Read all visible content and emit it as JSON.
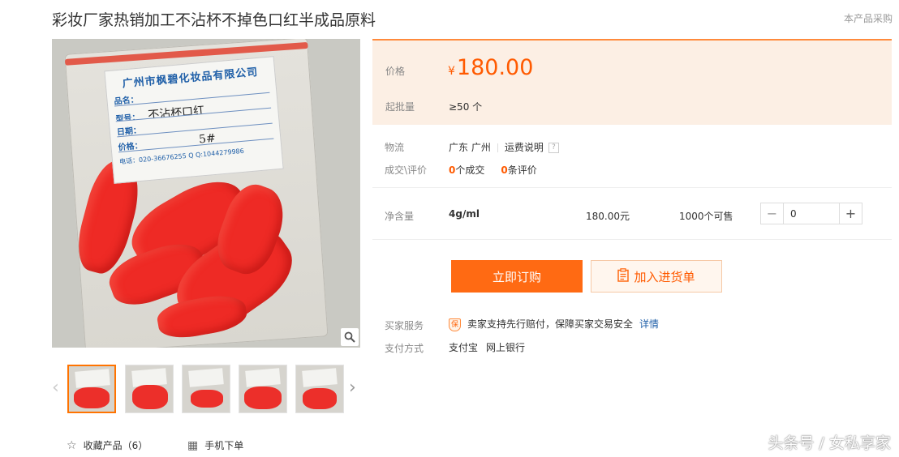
{
  "product": {
    "title": "彩妆厂家热销加工不沾杯不掉色口红半成品原料",
    "purchase_link": "本产品采购"
  },
  "image_label": {
    "company": "广州市枫碧化妆品有限公司",
    "name_label": "品名：",
    "model_label": "型号：",
    "model_value": "不沾杯口红",
    "date_label": "日期：",
    "price_label": "价格：",
    "price_value": "5#",
    "contact": "电话：020-36676255   Q Q:1044279986"
  },
  "price_section": {
    "price_label": "价格",
    "currency": "¥",
    "price": "180.00",
    "moq_label": "起批量",
    "moq_value": "≥50 个"
  },
  "logistics": {
    "label": "物流",
    "location": "广东 广州",
    "shipping_link": "运费说明",
    "help_icon": "?"
  },
  "deals": {
    "label": "成交\\评价",
    "orders_count": "0",
    "orders_text": "个成交",
    "reviews_count": "0",
    "reviews_text": "条评价"
  },
  "sku": {
    "label": "净含量",
    "spec": "4g/ml",
    "price": "180.00元",
    "stock": "1000个可售",
    "quantity": "0",
    "minus": "−",
    "plus": "+"
  },
  "actions": {
    "buy_now": "立即订购",
    "add_to_list": "加入进货单"
  },
  "services": {
    "label": "买家服务",
    "badge": "保",
    "text": "卖家支持先行赔付，保障买家交易安全",
    "link": "详情"
  },
  "payment": {
    "label": "支付方式",
    "methods": [
      "支付宝",
      "网上银行"
    ]
  },
  "footer": {
    "favorite": "收藏产品（6）",
    "mobile_order": "手机下单"
  },
  "watermark": "头条号 / 女私享家",
  "colors": {
    "accent": "#ff5a00",
    "buy_button": "#ff6a13",
    "price_bg": "#fcefe4",
    "link": "#1f5fa8"
  },
  "icons": [
    "zoom-icon",
    "chevron-left-icon",
    "chevron-right-icon",
    "star-icon",
    "qr-code-icon",
    "clipboard-icon",
    "shield-icon",
    "help-icon"
  ]
}
